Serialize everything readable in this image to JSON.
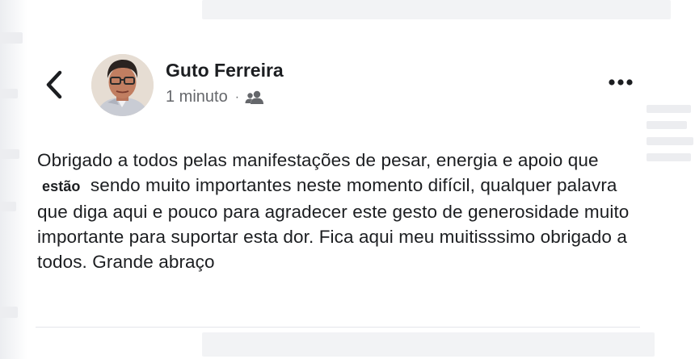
{
  "post": {
    "author": "Guto Ferreira",
    "timestamp": "1 minuto",
    "separator": "·",
    "audience_icon": "friends-icon",
    "text_part1": "Obrigado a todos pelas manifestações de pesar, energia e apoio que",
    "text_highlight": "estão",
    "text_part2": "sendo muito importantes neste momento difícil, qualquer palavra que diga aqui e pouco para agradecer este gesto de generosidade muito importante para suportar esta dor. Fica aqui meu muitisssimo obrigado a todos. Grande abraço"
  },
  "icons": {
    "back": "chevron-left-icon",
    "more": "more-horizontal-icon"
  },
  "colors": {
    "text_primary": "#1c1e21",
    "text_secondary": "#65676b",
    "background": "#ffffff"
  }
}
